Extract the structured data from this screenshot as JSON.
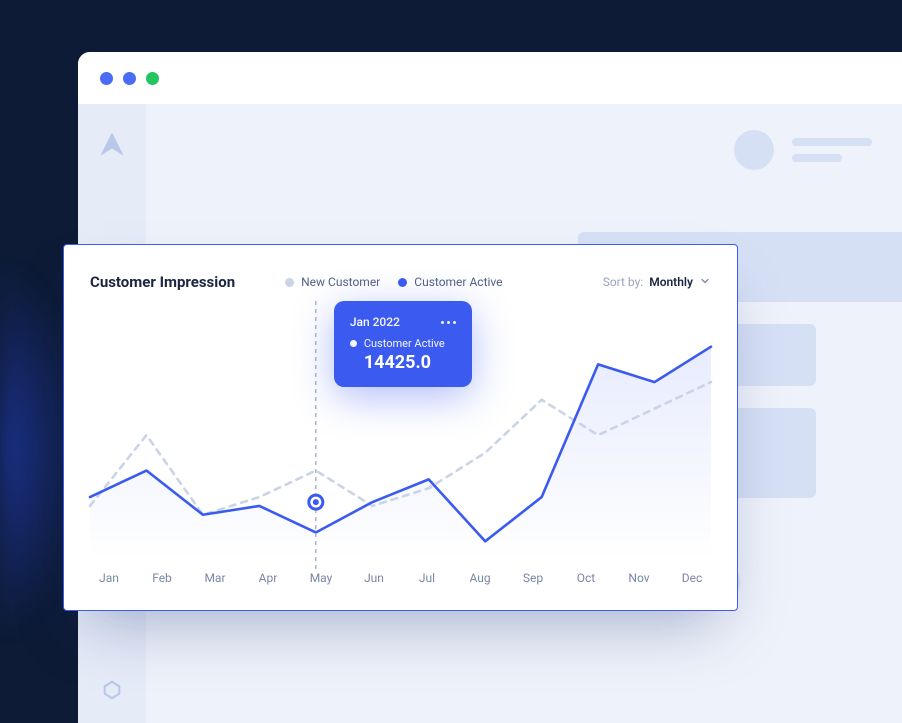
{
  "chart": {
    "title": "Customer Impression",
    "legend": {
      "new_customer": "New Customer",
      "customer_active": "Customer Active"
    },
    "sort": {
      "label": "Sort by:",
      "value": "Monthly"
    },
    "tooltip": {
      "date": "Jan 2022",
      "series_label": "Customer Active",
      "value": "14425.0"
    }
  },
  "chart_data": {
    "type": "line",
    "categories": [
      "Jan",
      "Feb",
      "Mar",
      "Apr",
      "May",
      "Jun",
      "Jul",
      "Aug",
      "Sep",
      "Oct",
      "Nov",
      "Dec"
    ],
    "series": [
      {
        "name": "New Customer",
        "style": "dashed",
        "color": "#cbd3e6",
        "values": [
          14000,
          22000,
          13000,
          15000,
          18000,
          14000,
          16000,
          20000,
          26000,
          22000,
          25000,
          28000
        ]
      },
      {
        "name": "Customer Active",
        "style": "solid",
        "color": "#3b5bf0",
        "values": [
          15000,
          18000,
          13000,
          14000,
          11000,
          14425,
          17000,
          10000,
          15000,
          30000,
          28000,
          32000
        ]
      }
    ],
    "ylim": [
      8000,
      34000
    ],
    "highlight": {
      "category": "May",
      "series": "Customer Active",
      "value": 14425.0
    },
    "xlabel": "",
    "ylabel": ""
  },
  "colors": {
    "accent": "#3b5bf0",
    "muted": "#cbd3e6",
    "bg_dark": "#0d1b36"
  }
}
